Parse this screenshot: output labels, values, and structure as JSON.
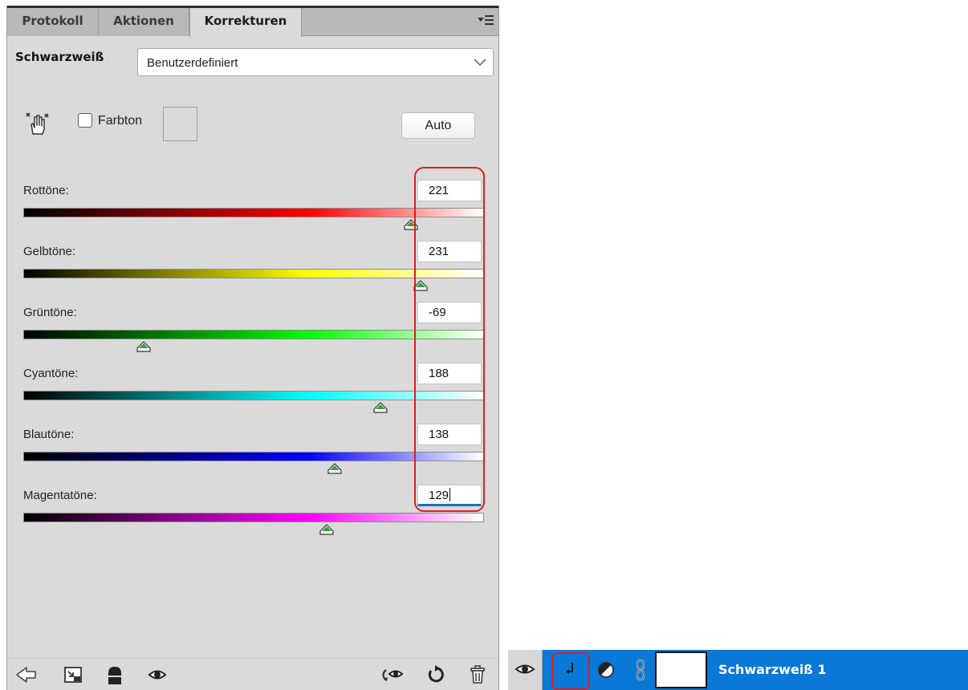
{
  "panel": {
    "tabs": [
      {
        "label": "Protokoll",
        "active": false
      },
      {
        "label": "Aktionen",
        "active": false
      },
      {
        "label": "Korrekturen",
        "active": true
      }
    ],
    "panel_menu_icon": "panel-menu-icon"
  },
  "adjustment": {
    "title": "Schwarzweiß",
    "preset": "Benutzerdefiniert",
    "tint_label": "Farbton",
    "tint_checked": false,
    "auto_label": "Auto",
    "slider_range": [
      -200,
      300
    ],
    "sliders": [
      {
        "label": "Rottöne:",
        "value": "221",
        "gradient": [
          "#000000",
          "#ff0000",
          "#ffffff"
        ]
      },
      {
        "label": "Gelbtöne:",
        "value": "231",
        "gradient": [
          "#000000",
          "#ffff00",
          "#ffffff"
        ]
      },
      {
        "label": "Grüntöne:",
        "value": "-69",
        "gradient": [
          "#000000",
          "#00ff00",
          "#ffffff"
        ]
      },
      {
        "label": "Cyantöne:",
        "value": "188",
        "gradient": [
          "#000000",
          "#00ffff",
          "#ffffff"
        ]
      },
      {
        "label": "Blautöne:",
        "value": "138",
        "gradient": [
          "#000000",
          "#0000ff",
          "#ffffff"
        ]
      },
      {
        "label": "Magentatöne:",
        "value": "129",
        "gradient": [
          "#000000",
          "#ff00ff",
          "#ffffff"
        ]
      }
    ],
    "focused_slider": 5
  },
  "footer_icons": [
    "clip-to-layer-back-icon",
    "layer-view-icon",
    "mask-icon",
    "visibility-eye-icon",
    "previous-state-icon",
    "reset-icon",
    "trash-icon"
  ],
  "layer": {
    "name": "Schwarzweiß 1",
    "visible": true,
    "clipped": true
  },
  "colors": {
    "panel_bg": "#dadada",
    "tab_bar": "#b9b9b9",
    "selection_blue": "#0a78d6",
    "highlight_red": "#e31b1b",
    "thumb_green": "#3c9c46"
  }
}
